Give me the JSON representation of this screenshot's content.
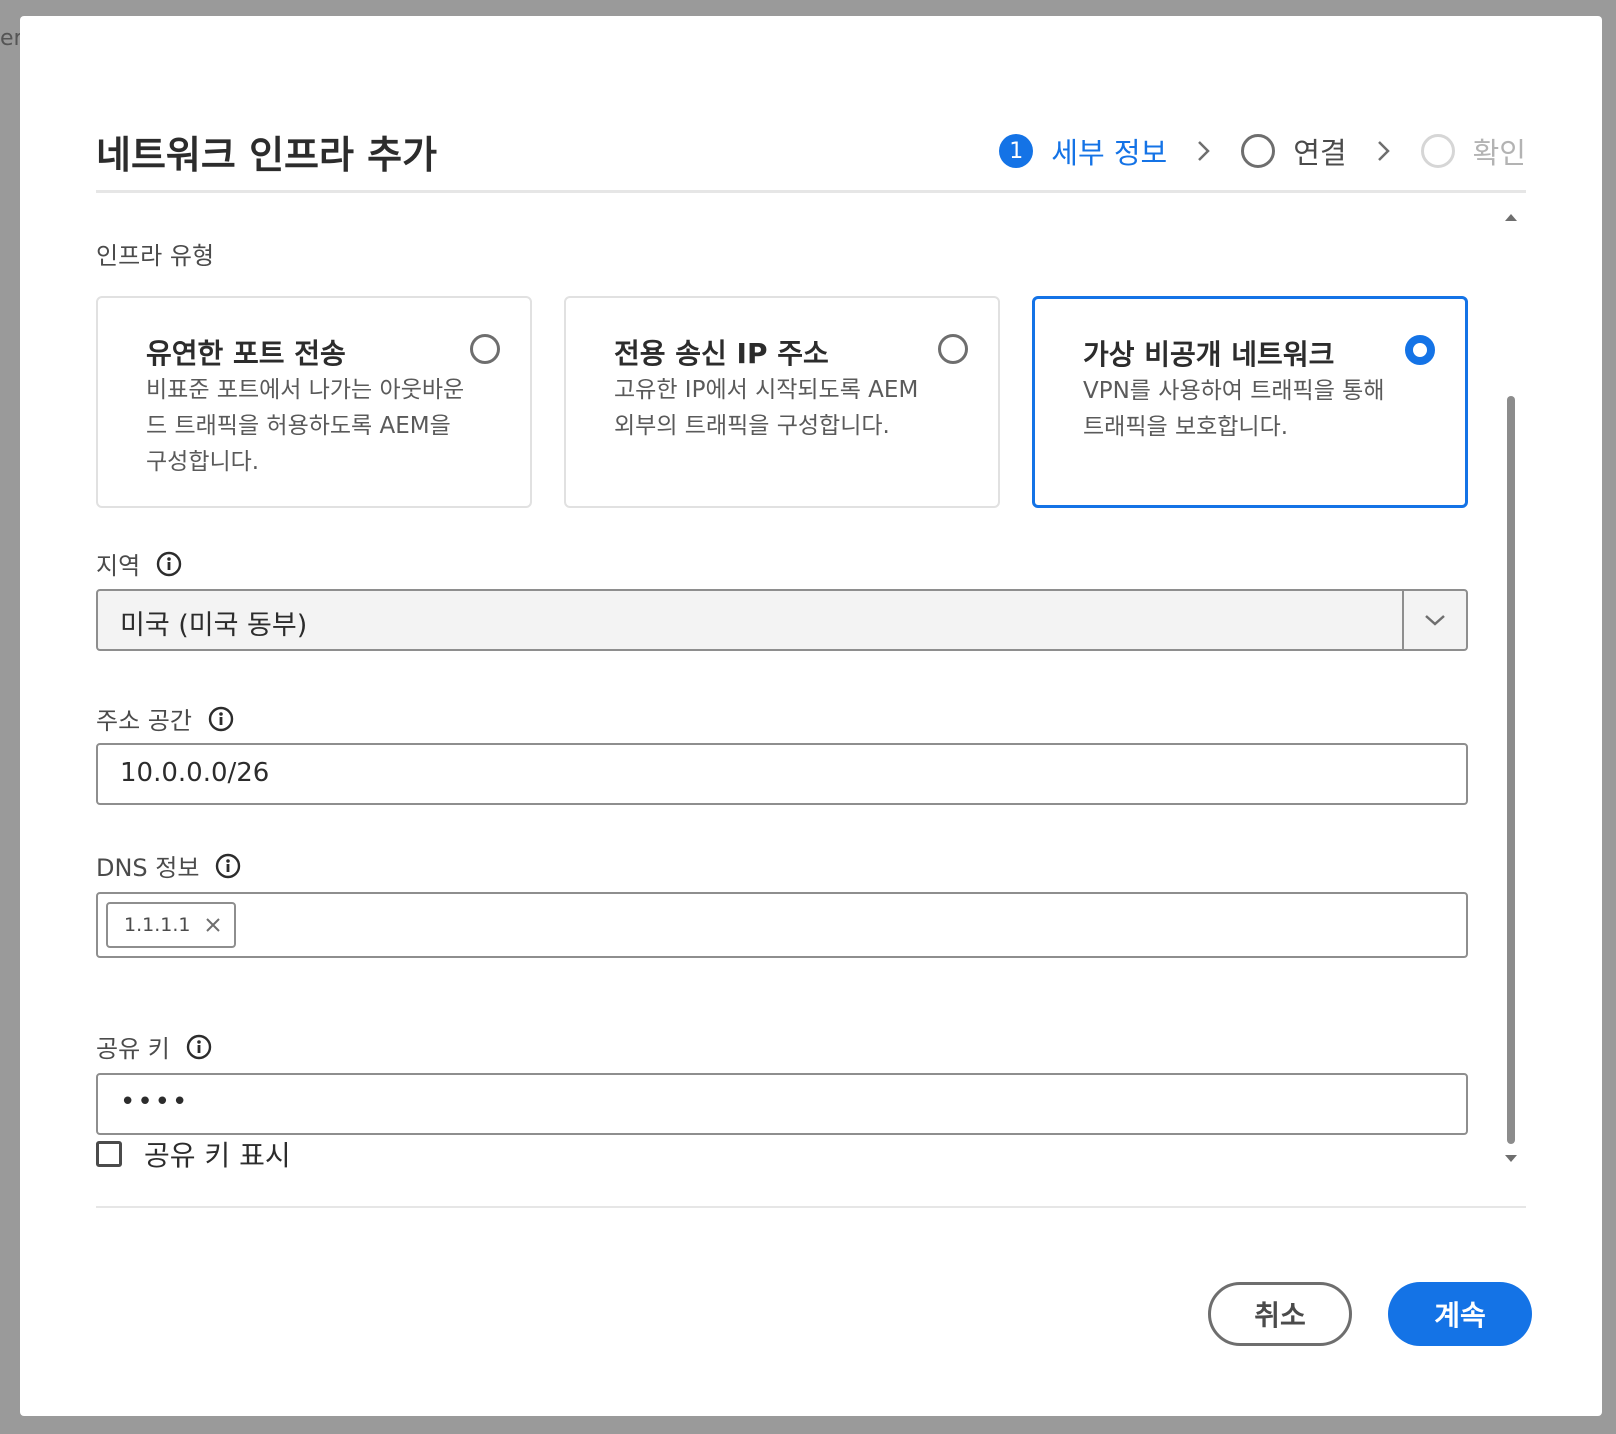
{
  "backdrop": {
    "peek_text": "er"
  },
  "dialog": {
    "title": "네트워크 인프라 추가",
    "steps": [
      {
        "number": "1",
        "label": "세부 정보",
        "state": "active"
      },
      {
        "number": "",
        "label": "연결",
        "state": "pending"
      },
      {
        "number": "",
        "label": "확인",
        "state": "disabled"
      }
    ]
  },
  "infra_type": {
    "label": "인프라 유형",
    "options": [
      {
        "title": "유연한 포트 전송",
        "description": "비표준 포트에서 나가는 아웃바운드 트래픽을 허용하도록 AEM을 구성합니다.",
        "selected": false
      },
      {
        "title": "전용 송신 IP 주소",
        "description": "고유한 IP에서 시작되도록 AEM 외부의 트래픽을 구성합니다.",
        "selected": false
      },
      {
        "title": "가상 비공개 네트워크",
        "description": "VPN를 사용하여 트래픽을 통해 트래픽을 보호합니다.",
        "selected": true
      }
    ]
  },
  "region": {
    "label": "지역",
    "value": "미국 (미국 동부)",
    "icon": "info-icon"
  },
  "address_space": {
    "label": "주소 공간",
    "value": "10.0.0.0/26",
    "icon": "info-icon"
  },
  "dns": {
    "label": "DNS 정보",
    "tags": [
      "1.1.1.1"
    ],
    "icon": "info-icon"
  },
  "shared_key": {
    "label": "공유 키",
    "value": "••••",
    "show_label": "공유 키 표시",
    "show_checked": false,
    "icon": "info-icon"
  },
  "footer": {
    "cancel_label": "취소",
    "continue_label": "계속"
  },
  "colors": {
    "accent": "#1473e6",
    "border": "#8e8e8e",
    "text": "#2c2c2c"
  }
}
